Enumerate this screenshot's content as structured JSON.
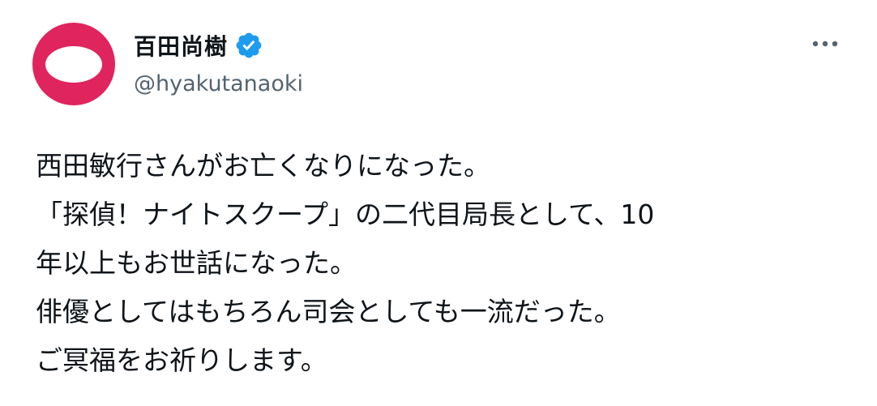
{
  "tweet": {
    "author": {
      "display_name": "百田尚樹",
      "handle": "@hyakutanaoki",
      "verified_icon": "verified-badge-icon",
      "avatar_color": "#e0245e"
    },
    "more_icon": "more-horizontal-icon",
    "text_lines": [
      "西田敏行さんがお亡くなりになった。",
      "「探偵！ナイトスクープ」の二代目局長として、10",
      "年以上もお世話になった。",
      "俳優としてはもちろん司会としても一流だった。",
      "ご冥福をお祈りします。"
    ]
  },
  "colors": {
    "text_primary": "#0f1419",
    "text_secondary": "#536471",
    "verified_blue": "#1d9bf0",
    "background": "#ffffff"
  }
}
